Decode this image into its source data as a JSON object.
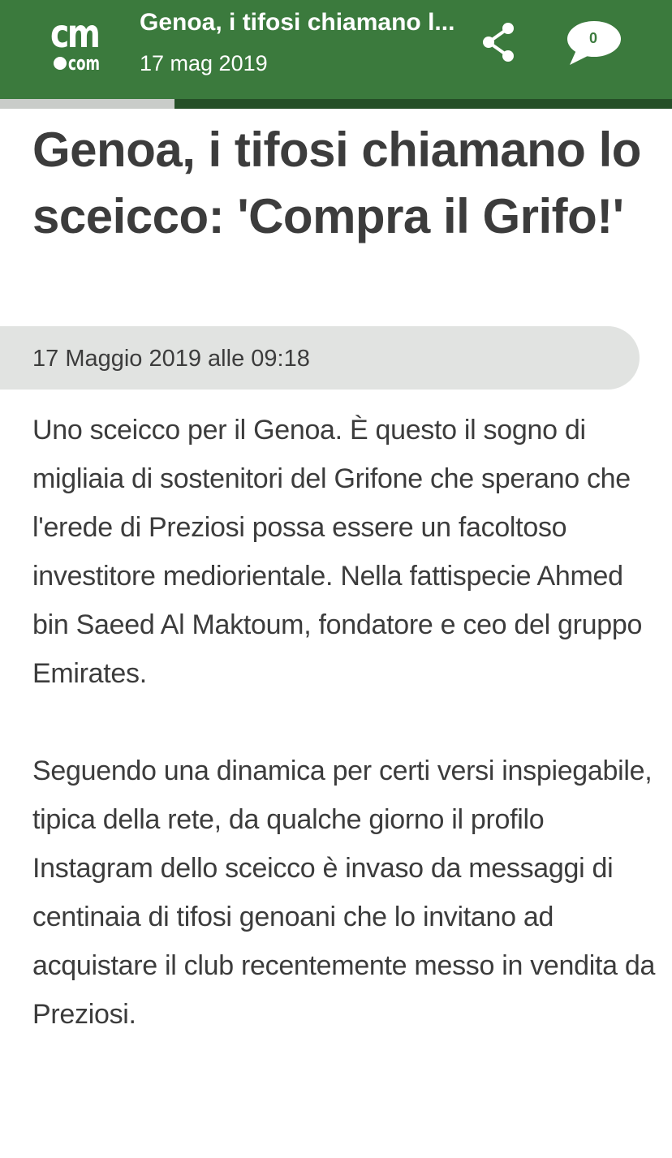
{
  "header": {
    "logo_top": "cm",
    "logo_bottom": "com",
    "title": "Genoa, i tifosi chiamano l...",
    "date": "17 mag 2019",
    "comment_count": "0",
    "icons": [
      "share-icon",
      "comment-bubble-icon"
    ],
    "brand_color": "#3b7a3d"
  },
  "progress": {
    "read_fraction": 0.26
  },
  "article": {
    "title": "Genoa, i tifosi chiamano lo sceicco: 'Compra il Grifo!'",
    "datetime": "17 Maggio 2019 alle 09:18",
    "paragraphs": [
      "Uno sceicco per il Genoa. È questo il sogno di migliaia di sostenitori del Grifone che sperano che l'erede di Preziosi possa essere un facoltoso investitore mediorientale. Nella fattispecie Ahmed bin Saeed Al Maktoum, fondatore e ceo del gruppo Emirates.",
      "Seguendo una dinamica per certi versi inspiegabile, tipica della rete, da qualche giorno il profilo Instagram dello sceicco è invaso da messaggi di centinaia di tifosi genoani che lo invitano ad acquistare il club recentemente messo in vendita da Preziosi."
    ]
  }
}
